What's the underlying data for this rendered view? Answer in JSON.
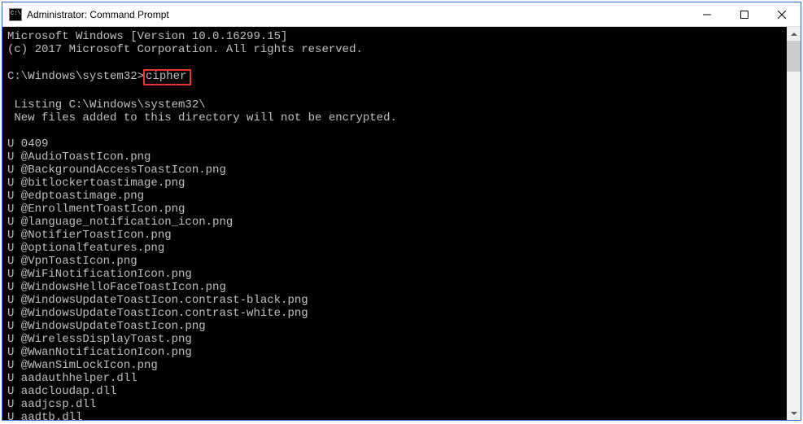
{
  "window": {
    "title": "Administrator: Command Prompt"
  },
  "terminal": {
    "line_os": "Microsoft Windows [Version 10.0.16299.15]",
    "line_copyright": "(c) 2017 Microsoft Corporation. All rights reserved.",
    "prompt_prefix": "C:\\Windows\\system32>",
    "command": "cipher",
    "listing_header": " Listing C:\\Windows\\system32\\",
    "listing_note": " New files added to this directory will not be encrypted.",
    "entries": [
      "U 0409",
      "U @AudioToastIcon.png",
      "U @BackgroundAccessToastIcon.png",
      "U @bitlockertoastimage.png",
      "U @edptoastimage.png",
      "U @EnrollmentToastIcon.png",
      "U @language_notification_icon.png",
      "U @NotifierToastIcon.png",
      "U @optionalfeatures.png",
      "U @VpnToastIcon.png",
      "U @WiFiNotificationIcon.png",
      "U @WindowsHelloFaceToastIcon.png",
      "U @WindowsUpdateToastIcon.contrast-black.png",
      "U @WindowsUpdateToastIcon.contrast-white.png",
      "U @WindowsUpdateToastIcon.png",
      "U @WirelessDisplayToast.png",
      "U @WwanNotificationIcon.png",
      "U @WwanSimLockIcon.png",
      "U aadauthhelper.dll",
      "U aadcloudap.dll",
      "U aadjcsp.dll",
      "U aadtb.dll"
    ]
  }
}
